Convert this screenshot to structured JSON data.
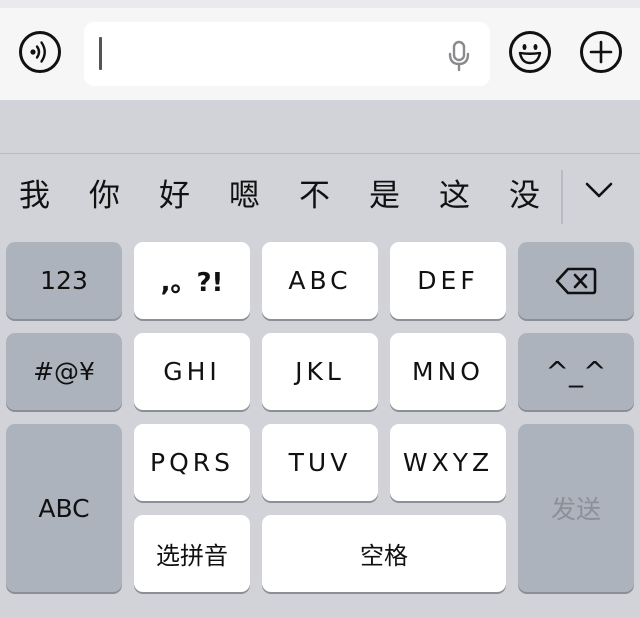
{
  "input_bar": {
    "voice_button_icon": "voice-icon",
    "text_field_value": "",
    "mic_icon": "microphone-icon",
    "emoji_button_icon": "smiley-icon",
    "plus_button_icon": "plus-icon"
  },
  "candidates": {
    "items": [
      "我",
      "你",
      "好",
      "嗯",
      "不",
      "是",
      "这",
      "没"
    ],
    "expand_icon": "chevron-down-icon"
  },
  "keyboard": {
    "left_column": [
      "123",
      "#@¥",
      "ABC"
    ],
    "grid": [
      ",。?!",
      "ABC",
      "DEF",
      "GHI",
      "JKL",
      "MNO",
      "PQRS",
      "TUV",
      "WXYZ"
    ],
    "pinyin_select": "选拼音",
    "space": "空格",
    "delete_icon": "backspace-icon",
    "emoticon": "^_^",
    "send": "发送"
  },
  "colors": {
    "keyboard_bg": "#d1d3d9",
    "function_key": "#adb3bd",
    "letter_key": "#ffffff",
    "send_disabled_text": "#8b8f97"
  }
}
